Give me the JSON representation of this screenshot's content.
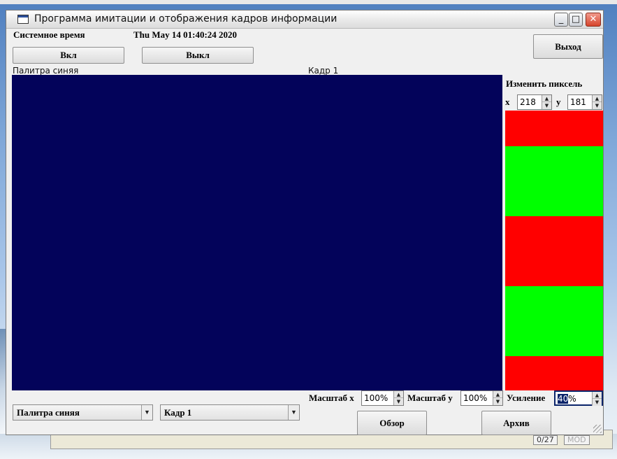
{
  "window": {
    "title": "Программа имитации и отображения кадров информации",
    "minimize_glyph": "_",
    "maximize_glyph": "□",
    "close_glyph": "✕"
  },
  "system_time": {
    "label": "Системное время",
    "value": "Thu May 14 01:40:24 2020"
  },
  "buttons": {
    "on": "Вкл",
    "off": "Выкл",
    "exit": "Выход",
    "browse": "Обзор",
    "archive": "Архив"
  },
  "captions": {
    "palette": "Палитра синяя",
    "frame": "Кадр 1"
  },
  "pixel_editor": {
    "title": "Изменить пиксель",
    "x_label": "x",
    "x_value": "218",
    "y_label": "y",
    "y_value": "181"
  },
  "color_strip": {
    "segments": [
      "#ff0000",
      "#00ff00",
      "#ff0000",
      "#00ff00",
      "#ff0000"
    ]
  },
  "canvas": {
    "color": "#03035a"
  },
  "scale": {
    "x_label": "Масштаб x",
    "x_value": "100%",
    "y_label": "Масштаб y",
    "y_value": "100%"
  },
  "gain": {
    "label": "Усиление",
    "value_selected": "40",
    "value_rest": "%"
  },
  "combos": {
    "palette": "Палитра синяя",
    "frame": "Кадр 1"
  },
  "background_window": {
    "status_1": "0/27",
    "status_2": "MOD"
  },
  "icons": {
    "spin_up": "▲",
    "spin_down": "▼",
    "dropdown": "▼"
  }
}
